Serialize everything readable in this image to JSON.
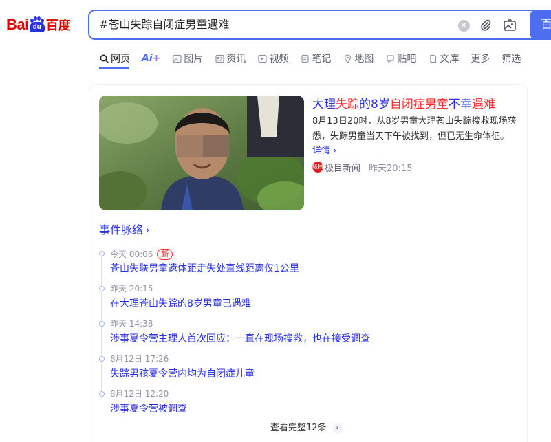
{
  "logo": {
    "bai": "Bai",
    "du": "du",
    "cn": "百度"
  },
  "search": {
    "query": "#苍山失踪自闭症男童遇难",
    "button_label": "百"
  },
  "tabs": [
    {
      "label": "网页"
    },
    {
      "label": "Ai"
    },
    {
      "label": "图片"
    },
    {
      "label": "资讯"
    },
    {
      "label": "视频"
    },
    {
      "label": "笔记"
    },
    {
      "label": "地图"
    },
    {
      "label": "贴吧"
    },
    {
      "label": "文库"
    },
    {
      "label": "更多"
    },
    {
      "label": "筛选"
    }
  ],
  "news": {
    "title_parts": [
      "大理",
      "失踪",
      "的8岁",
      "自闭症男童",
      "不幸",
      "遇难"
    ],
    "summary": "8月13日20时，从8岁男童大理苍山失踪搜救现场获悉，失踪男童当天下午被找到，但已无生命体征。",
    "more": "详情",
    "source_logo": "极目",
    "source": "极目新闻",
    "time": "昨天20:15"
  },
  "timeline": {
    "heading": "事件脉络",
    "new_badge": "新",
    "items": [
      {
        "time": "今天 00:06",
        "text": "苍山失联男童遗体距走失处直线距离仅1公里"
      },
      {
        "time": "昨天 20:15",
        "text": "在大理苍山失踪的8岁男童已遇难"
      },
      {
        "time": "昨天 14:38",
        "text": "涉事夏令营主理人首次回应：一直在现场搜救，也在接受调查"
      },
      {
        "time": "8月12日 17:26",
        "text": "失踪男孩夏令营内均为自闭症儿童"
      },
      {
        "time": "8月12日 12:20",
        "text": "涉事夏令营被调查"
      }
    ],
    "view_all": "查看完整12条"
  },
  "colors": {
    "brand_blue": "#4e6ef2",
    "link_blue": "#2932e1",
    "highlight_red": "#f73131"
  }
}
